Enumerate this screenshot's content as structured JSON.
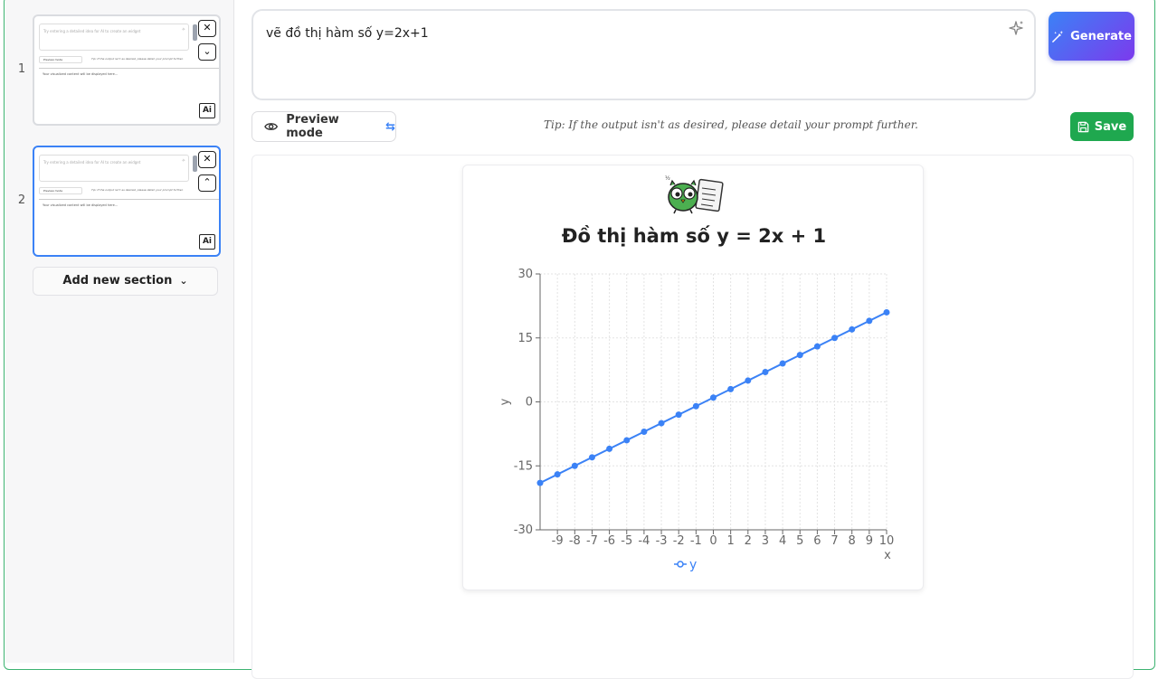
{
  "sidebar": {
    "thumbnails": [
      {
        "number": "1",
        "placeholder": "Try entering a detailed idea for AI to create an widget",
        "preview_label": "Preview mode",
        "tip": "Tip: If the output isn't as desired, please detail your prompt further.",
        "body": "Your visualized content will be displayed here..."
      },
      {
        "number": "2",
        "placeholder": "Try entering a detailed idea for AI to create an widget",
        "preview_label": "Preview mode",
        "tip": "Tip: If the output isn't as desired, please detail your prompt further.",
        "body": "Your visualized content will be displayed here..."
      }
    ],
    "ai_badge": "Ai",
    "add_section_label": "Add new section"
  },
  "prompt": {
    "value": "vẽ đồ thị hàm số y=2x+1"
  },
  "toolbar": {
    "generate_label": "Generate",
    "preview_label": "Preview mode",
    "tip": "Tip: If the output isn't as desired, please detail your prompt further.",
    "save_label": "Save"
  },
  "colors": {
    "accent": "#3b82f6",
    "generate_gradient_end": "#7c3aed",
    "save": "#1fa84f",
    "border_frame": "#3cb371",
    "line": "#3b82f6"
  },
  "icons": {
    "sparkle": "sparkle-icon",
    "generate": "magic-wand-icon",
    "preview": "eye-icon",
    "swap": "swap-arrows-icon",
    "save": "floppy-disk-icon",
    "close": "close-icon",
    "chevron_down": "chevron-down-icon",
    "chevron_up": "chevron-up-icon"
  },
  "chart_data": {
    "type": "line",
    "title": "Đồ thị hàm số y = 2x + 1",
    "xlabel": "x",
    "ylabel": "y",
    "x": [
      -10,
      -9,
      -8,
      -7,
      -6,
      -5,
      -4,
      -3,
      -2,
      -1,
      0,
      1,
      2,
      3,
      4,
      5,
      6,
      7,
      8,
      9,
      10
    ],
    "series": [
      {
        "name": "y",
        "values": [
          -19,
          -17,
          -15,
          -13,
          -11,
          -9,
          -7,
          -5,
          -3,
          -1,
          1,
          3,
          5,
          7,
          9,
          11,
          13,
          15,
          17,
          19,
          21
        ]
      }
    ],
    "xticks": [
      "-9",
      "-8",
      "-7",
      "-6",
      "-5",
      "-4",
      "-3",
      "-2",
      "-1",
      "0",
      "1",
      "2",
      "3",
      "4",
      "5",
      "6",
      "7",
      "8",
      "9",
      "10"
    ],
    "yticks": [
      "30",
      "15",
      "0",
      "-15",
      "-30"
    ],
    "xlim": [
      -10,
      10
    ],
    "ylim": [
      -30,
      30
    ],
    "grid": true,
    "legend": "bottom"
  }
}
